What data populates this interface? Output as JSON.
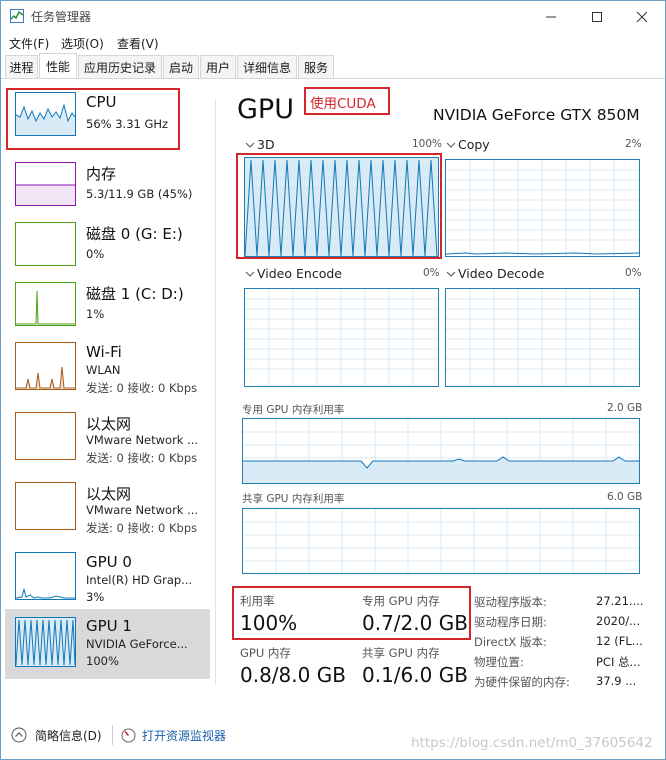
{
  "window": {
    "title": "任务管理器"
  },
  "menu": {
    "file": "文件(F)",
    "options": "选项(O)",
    "view": "查看(V)"
  },
  "tabs": [
    "进程",
    "性能",
    "应用历史记录",
    "启动",
    "用户",
    "详细信息",
    "服务"
  ],
  "sidebar": [
    {
      "title": "CPU",
      "line1": "56% 3.31 GHz",
      "line2": ""
    },
    {
      "title": "内存",
      "line1": "5.3/11.9 GB (45%)",
      "line2": ""
    },
    {
      "title": "磁盘 0 (G: E:)",
      "line1": "0%",
      "line2": ""
    },
    {
      "title": "磁盘 1 (C: D:)",
      "line1": "1%",
      "line2": ""
    },
    {
      "title": "Wi-Fi",
      "line1": "WLAN",
      "line2": "发送: 0 接收: 0 Kbps"
    },
    {
      "title": "以太网",
      "line1": "VMware Network ...",
      "line2": "发送: 0 接收: 0 Kbps"
    },
    {
      "title": "以太网",
      "line1": "VMware Network ...",
      "line2": "发送: 0 接收: 0 Kbps"
    },
    {
      "title": "GPU 0",
      "line1": "Intel(R) HD Grap...",
      "line2": "3%"
    },
    {
      "title": "GPU 1",
      "line1": "NVIDIA GeForce...",
      "line2": "100%"
    }
  ],
  "main": {
    "heading": "GPU",
    "annotation": "使用CUDA",
    "device": "NVIDIA GeForce GTX 850M",
    "graphs": [
      {
        "label": "3D",
        "pct": "100%"
      },
      {
        "label": "Copy",
        "pct": "2%"
      },
      {
        "label": "Video Encode",
        "pct": "0%"
      },
      {
        "label": "Video Decode",
        "pct": "0%"
      }
    ],
    "dedicated_label": "专用 GPU 内存利用率",
    "dedicated_max": "2.0 GB",
    "shared_label": "共享 GPU 内存利用率",
    "shared_max": "6.0 GB",
    "stats": {
      "util_label": "利用率",
      "util_value": "100%",
      "ded_label": "专用 GPU 内存",
      "ded_value": "0.7/2.0 GB",
      "gpu_mem_label": "GPU 内存",
      "gpu_mem_value": "0.8/8.0 GB",
      "shared_mem_label": "共享 GPU 内存",
      "shared_mem_value": "0.1/6.0 GB"
    },
    "info": [
      {
        "k": "驱动程序版本:",
        "v": "27.21...."
      },
      {
        "k": "驱动程序日期:",
        "v": "2020/..."
      },
      {
        "k": "DirectX 版本:",
        "v": "12 (FL..."
      },
      {
        "k": "物理位置:",
        "v": "PCI 总..."
      },
      {
        "k": "为硬件保留的内存:",
        "v": "37.9 ..."
      }
    ]
  },
  "footer": {
    "brief": "简略信息(D)",
    "monitor": "打开资源监视器",
    "watermark": "https://blog.csdn.net/m0_37605642"
  },
  "colors": {
    "accent": "#1178b8",
    "memory": "#8b12ae",
    "disk": "#4ea017",
    "net": "#a75a16",
    "annotation": "#d5262b"
  }
}
